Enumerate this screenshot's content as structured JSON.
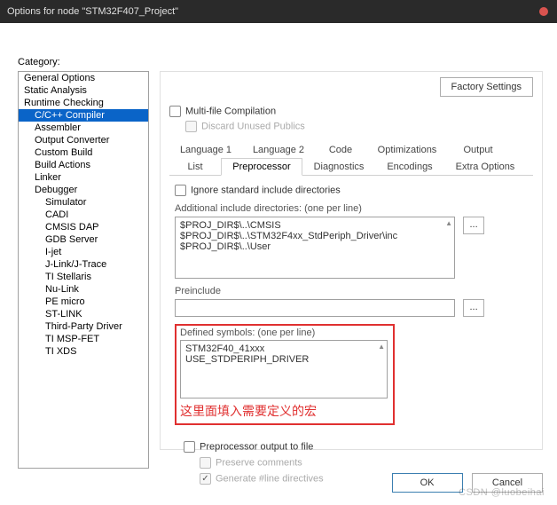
{
  "window": {
    "title": "Options for node \"STM32F407_Project\""
  },
  "sidebar": {
    "label": "Category:",
    "items": [
      {
        "label": "General Options",
        "lvl": 0
      },
      {
        "label": "Static Analysis",
        "lvl": 0
      },
      {
        "label": "Runtime Checking",
        "lvl": 0
      },
      {
        "label": "C/C++ Compiler",
        "lvl": 1,
        "sel": true
      },
      {
        "label": "Assembler",
        "lvl": 1
      },
      {
        "label": "Output Converter",
        "lvl": 1
      },
      {
        "label": "Custom Build",
        "lvl": 1
      },
      {
        "label": "Build Actions",
        "lvl": 1
      },
      {
        "label": "Linker",
        "lvl": 1
      },
      {
        "label": "Debugger",
        "lvl": 1
      },
      {
        "label": "Simulator",
        "lvl": 2
      },
      {
        "label": "CADI",
        "lvl": 2
      },
      {
        "label": "CMSIS DAP",
        "lvl": 2
      },
      {
        "label": "GDB Server",
        "lvl": 2
      },
      {
        "label": "I-jet",
        "lvl": 2
      },
      {
        "label": "J-Link/J-Trace",
        "lvl": 2
      },
      {
        "label": "TI Stellaris",
        "lvl": 2
      },
      {
        "label": "Nu-Link",
        "lvl": 2
      },
      {
        "label": "PE micro",
        "lvl": 2
      },
      {
        "label": "ST-LINK",
        "lvl": 2
      },
      {
        "label": "Third-Party Driver",
        "lvl": 2
      },
      {
        "label": "TI MSP-FET",
        "lvl": 2
      },
      {
        "label": "TI XDS",
        "lvl": 2
      }
    ]
  },
  "main": {
    "factory_btn": "Factory Settings",
    "mfc": "Multi-file Compilation",
    "dup": "Discard Unused Publics",
    "tabs_row1": [
      "Language 1",
      "Language 2",
      "Code",
      "Optimizations",
      "Output"
    ],
    "tabs_row2": [
      "List",
      "Preprocessor",
      "Diagnostics",
      "Encodings",
      "Extra Options"
    ],
    "active_tab": "Preprocessor",
    "ignore": "Ignore standard include directories",
    "addl_label": "Additional include directories: (one per line)",
    "addl_lines": [
      "$PROJ_DIR$\\..\\CMSIS",
      "$PROJ_DIR$\\..\\STM32F4xx_StdPeriph_Driver\\inc",
      "$PROJ_DIR$\\..\\User"
    ],
    "preinc_label": "Preinclude",
    "defsym_label": "Defined symbols: (one per line)",
    "defsym_lines": [
      "STM32F40_41xxx",
      "USE_STDPERIPH_DRIVER"
    ],
    "red_annotation": "这里面填入需要定义的宏",
    "pp_out": "Preprocessor output to file",
    "preserve": "Preserve comments",
    "gen_line": "Generate #line directives",
    "browse": "..."
  },
  "buttons": {
    "ok": "OK",
    "cancel": "Cancel"
  },
  "watermark": "CSDN @luobeihai"
}
